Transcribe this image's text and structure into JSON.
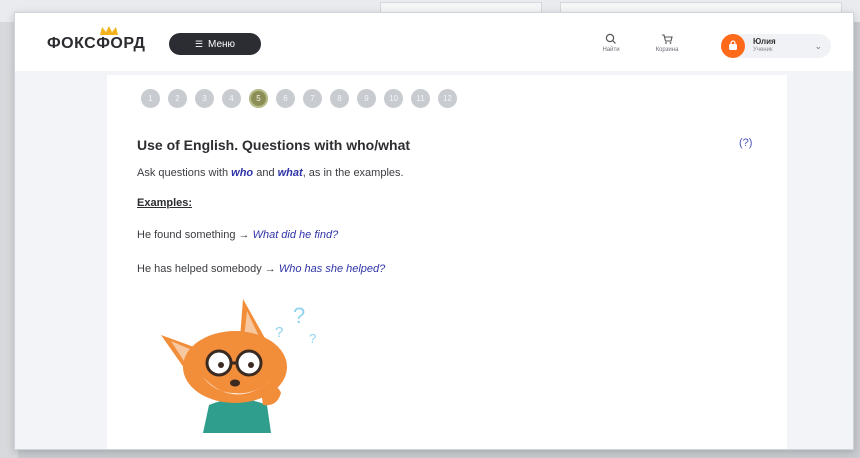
{
  "header": {
    "logo": "ФОКСФОРД",
    "menu_label": "Меню",
    "items": [
      {
        "label": "Найти",
        "icon": "search-icon"
      },
      {
        "label": "Корзина",
        "icon": "cart-icon"
      }
    ],
    "user": {
      "name": "Юлия",
      "subtitle": "Ученик"
    }
  },
  "task": {
    "steps": [
      "1",
      "2",
      "3",
      "4",
      "5",
      "6",
      "7",
      "8",
      "9",
      "10",
      "11",
      "12"
    ],
    "active_step": "5",
    "title": "Use of English. Questions with who/what",
    "help": "(?)",
    "instruction_pre": "Ask questions with ",
    "instruction_who": "who",
    "instruction_and": " and ",
    "instruction_what": "what",
    "instruction_post": ", as in the examples.",
    "examples_label": "Examples:",
    "examples": [
      {
        "sentence": "He found something",
        "arrow": " → ",
        "answer": "What did he find?"
      },
      {
        "sentence": "He has helped somebody",
        "arrow": " → ",
        "answer": "Who has she helped?"
      }
    ]
  },
  "colors": {
    "accent": "#ff6a1a",
    "link": "#2f34a8",
    "active_step": "#8b8f55"
  }
}
